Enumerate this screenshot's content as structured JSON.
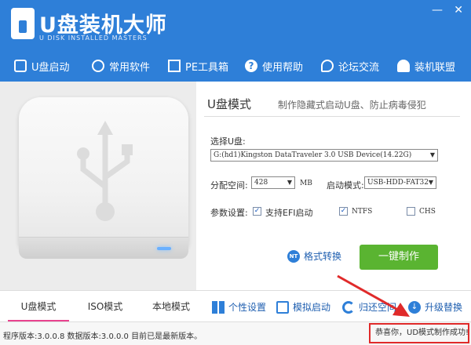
{
  "app": {
    "logo_title": "U盘装机大师",
    "logo_subtitle": "U DISK INSTALLED MASTERS",
    "minimize": "—",
    "close": "✕"
  },
  "nav": [
    {
      "label": "U盘启动",
      "icon": "usb-icon"
    },
    {
      "label": "常用软件",
      "icon": "gear-icon"
    },
    {
      "label": "PE工具箱",
      "icon": "toolbox-icon"
    },
    {
      "label": "使用帮助",
      "icon": "help-icon"
    },
    {
      "label": "论坛交流",
      "icon": "chat-icon"
    },
    {
      "label": "装机联盟",
      "icon": "people-icon"
    }
  ],
  "mode": {
    "title": "U盘模式",
    "description": "制作隐藏式启动U盘、防止病毒侵犯"
  },
  "form": {
    "disk_label": "选择U盘:",
    "disk_value": "G:(hd1)Kingston DataTraveler 3.0 USB Device(14.22G)",
    "partition_label": "分配空间:",
    "partition_value": "428",
    "partition_unit": "MB",
    "boot_mode_label": "启动模式:",
    "boot_mode_value": "USB-HDD-FAT32",
    "params_label": "参数设置:",
    "efi_label": "支持EFI启动",
    "efi_checked": true,
    "ntfs_label": "NTFS",
    "ntfs_checked": true,
    "chs_label": "CHS",
    "chs_checked": false,
    "check_mark": "✓"
  },
  "actions": {
    "format_icon_text": "NT",
    "format_label": "格式转换",
    "make_label": "一键制作"
  },
  "tabs": [
    {
      "label": "U盘模式",
      "active": true
    },
    {
      "label": "ISO模式",
      "active": false
    },
    {
      "label": "本地模式",
      "active": false
    }
  ],
  "tools": [
    {
      "label": "个性设置",
      "icon": "grid-icon"
    },
    {
      "label": "模拟启动",
      "icon": "monitor-icon"
    },
    {
      "label": "归还空间",
      "icon": "refresh-icon"
    },
    {
      "label": "升级替换",
      "icon": "download-icon"
    }
  ],
  "status": {
    "version_text": "程序版本:3.0.0.8  数据版本:3.0.0.0 目前已是最新版本。",
    "message": "恭喜你，UD模式制作成功!"
  },
  "colors": {
    "header": "#2e7fd8",
    "make_button": "#5ab431",
    "active_tab": "#e9438f",
    "annotation": "#e02a2a"
  }
}
